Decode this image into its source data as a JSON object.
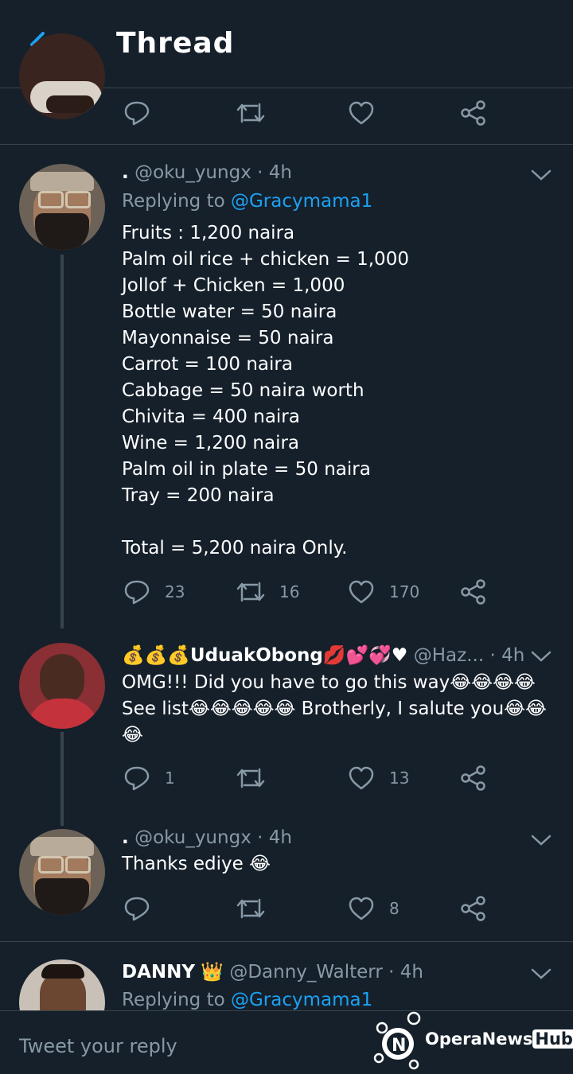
{
  "header": {
    "title": "Thread"
  },
  "prev_tweet": {
    "actions": {
      "reply": "",
      "retweet": "",
      "like": ""
    }
  },
  "tweets": [
    {
      "separator": " · ",
      "name": ".",
      "handle": "@oku_yungx",
      "time": "4h",
      "replying_prefix": "Replying to ",
      "replying_handle": "@Gracymama1",
      "text": "Fruits : 1,200 naira\nPalm oil rice + chicken = 1,000\nJollof + Chicken = 1,000\nBottle water = 50 naira\nMayonnaise = 50 naira\nCarrot = 100 naira\nCabbage = 50 naira worth\nChivita = 400 naira\nWine = 1,200 naira\nPalm oil in plate = 50 naira\nTray = 200 naira\n\nTotal = 5,200 naira Only.",
      "replies": "23",
      "retweets": "16",
      "likes": "170"
    },
    {
      "separator": " · ",
      "name": "💰💰💰UduakObong💋💕💞♥",
      "handle": "@Haz...",
      "time": "4h",
      "text": "OMG!!! Did you have to go this way😂😂😂😂\nSee list😂😂😂😂😂 Brotherly, I salute you😂😂\n😂",
      "replies": "1",
      "retweets": "",
      "likes": "13"
    },
    {
      "separator": " · ",
      "name": ".",
      "handle": "@oku_yungx",
      "time": "4h",
      "text": "Thanks ediye 😂",
      "replies": "",
      "retweets": "",
      "likes": "8"
    },
    {
      "separator": " · ",
      "name": "DANNY",
      "badge": "👑",
      "handle": "@Danny_Walterr",
      "time": "4h",
      "replying_prefix": "Replying to ",
      "replying_handle": "@Gracymama1"
    }
  ],
  "reply_bar": {
    "placeholder": "Tweet your reply"
  },
  "watermark": {
    "brand": "OperaNews",
    "hub": "Hub"
  },
  "colors": {
    "background": "#15202b",
    "accent": "#1da1f2",
    "muted": "#8899a6",
    "divider": "#38444d"
  }
}
